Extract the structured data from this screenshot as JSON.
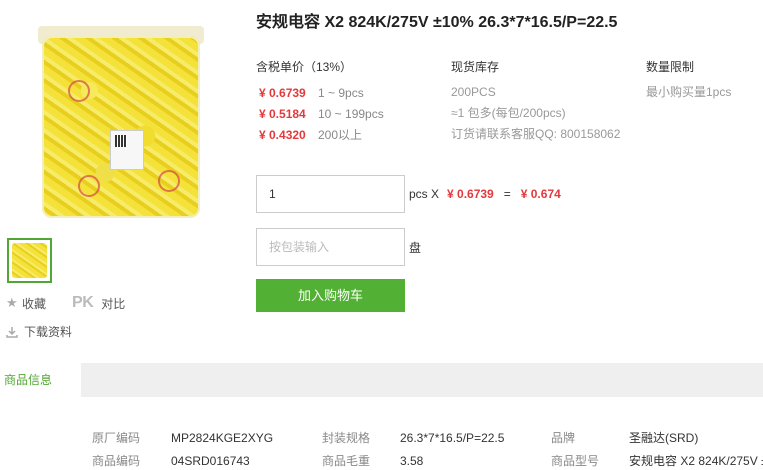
{
  "product": {
    "title": "安规电容 X2 824K/275V ±10% 26.3*7*16.5/P=22.5"
  },
  "gallery": {
    "main_alt": "product bag image"
  },
  "side": {
    "favorite_label": "收藏",
    "pk_icon_text": "PK",
    "compare_label": "对比",
    "download_label": "下载资料"
  },
  "pricing": {
    "unit_price_header": "含税单价（13%）",
    "tiers": [
      {
        "price": "¥ 0.6739",
        "range": "1 ~ 9pcs"
      },
      {
        "price": "¥ 0.5184",
        "range": "10 ~ 199pcs"
      },
      {
        "price": "¥ 0.4320",
        "range": "200以上"
      }
    ],
    "stock_header": "现货库存",
    "stock_lines": [
      "200PCS",
      "≈1 包多(每包/200pcs)",
      "订货请联系客服QQ: 800158062"
    ],
    "limit_header": "数量限制",
    "limit_text": "最小购买量1pcs"
  },
  "order": {
    "qty_value": "1",
    "unit_text": "pcs X",
    "unit_price": "¥ 0.6739",
    "equals": "=",
    "total": "¥ 0.674",
    "pack_placeholder": "按包装输入",
    "pack_unit": "盘",
    "cart_button": "加入购物车"
  },
  "tabs": {
    "active": "商品信息"
  },
  "specs": {
    "row1": [
      {
        "label": "原厂编码",
        "value": "MP2824KGE2XYG"
      },
      {
        "label": "封装规格",
        "value": "26.3*7*16.5/P=22.5"
      },
      {
        "label": "品牌",
        "value": "圣融达(SRD)"
      }
    ],
    "row2": [
      {
        "label": "商品编码",
        "value": "04SRD016743"
      },
      {
        "label": "商品毛重",
        "value": "3.58"
      },
      {
        "label": "商品型号",
        "value": "安规电容 X2 824K/275V ±"
      }
    ]
  },
  "colors": {
    "accent_green": "#52b134",
    "price_red": "#e4393c"
  }
}
